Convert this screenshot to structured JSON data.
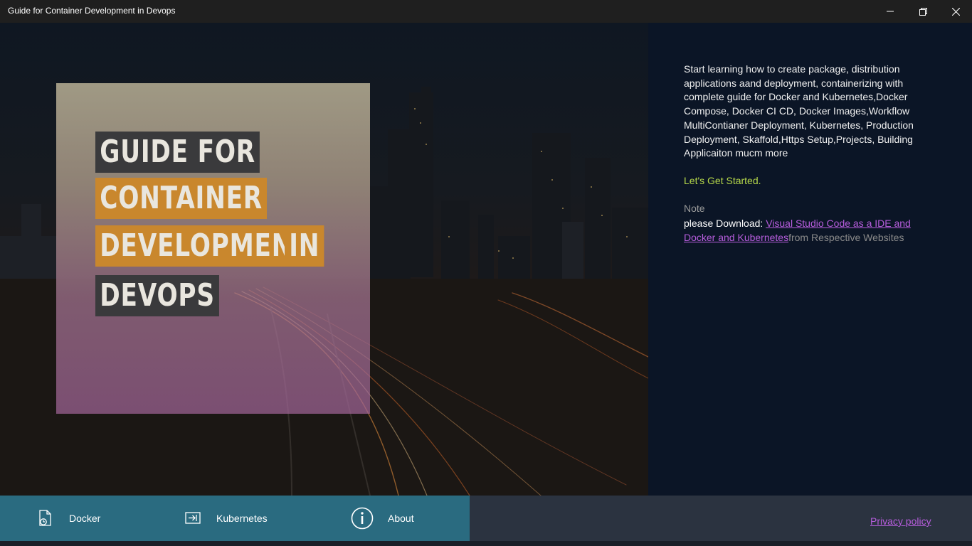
{
  "window": {
    "title": "Guide for Container Development in Devops",
    "minimize_icon": "minimize-icon",
    "maximize_icon": "restore-icon",
    "close_icon": "close-icon"
  },
  "cover": {
    "line1": "GUIDE FOR",
    "line2": "CONTAINER",
    "line3a": "DEVELOPMENT",
    "line3b": "IN",
    "line4": "DEVOPS"
  },
  "description": {
    "body": " Start learning how to create package, distribution applications aand deployment, containerizing with complete guide for Docker and Kubernetes,Docker Compose, Docker CI CD, Docker Images,Workflow MultiContianer Deployment, Kubernetes, Production Deployment, Skaffold,Https Setup,Projects, Building Applicaiton mucm more",
    "get_started": "Let's Get Started.",
    "note_label": "Note",
    "note_prefix": "please Download: ",
    "note_link": "Visual Studio Code as a IDE and Docker and Kubernetes",
    "note_suffix": "from Respective Websites"
  },
  "nav": {
    "items": [
      {
        "label": "Docker",
        "icon": "docker-file-icon"
      },
      {
        "label": "Kubernetes",
        "icon": "enter-arrow-icon"
      },
      {
        "label": "About",
        "icon": "info-icon"
      }
    ],
    "privacy": "Privacy policy"
  },
  "colors": {
    "accent_link": "#b65ddc",
    "get_started": "#b6d84a",
    "nav_panel": "#2a6b80",
    "bottom_bar": "#2b3340",
    "title_bar": "#1f1f1f"
  }
}
